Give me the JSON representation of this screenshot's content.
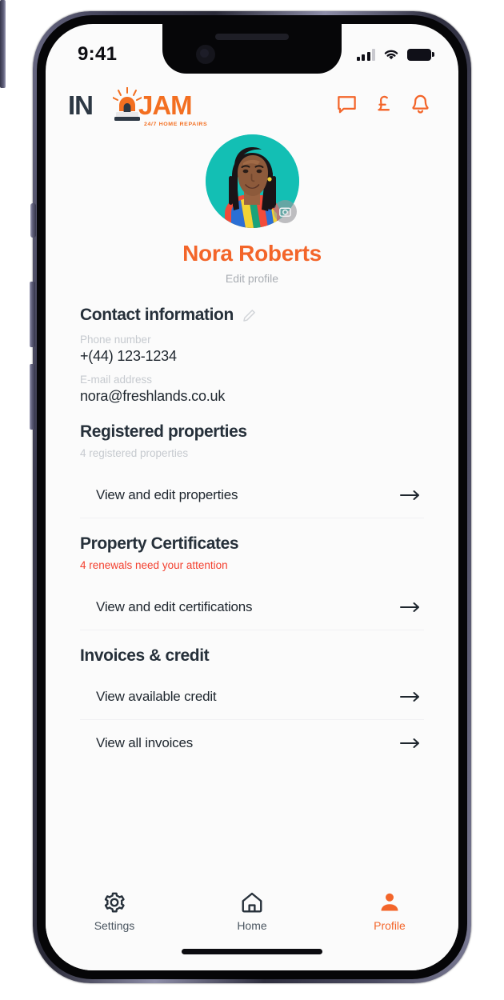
{
  "status_bar": {
    "time": "9:41",
    "signal_icon": "signal-bars-icon",
    "wifi_icon": "wifi-icon",
    "battery_icon": "battery-icon"
  },
  "header": {
    "logo": {
      "part1": "IN",
      "part2": "A",
      "part3": "JAM",
      "tagline": "24/7 HOME REPAIRS"
    },
    "icons": [
      {
        "name": "chat-icon",
        "label": "Messages"
      },
      {
        "name": "pound-icon",
        "label": "Payments"
      },
      {
        "name": "bell-icon",
        "label": "Notifications"
      }
    ]
  },
  "profile": {
    "name": "Nora Roberts",
    "edit_label": "Edit profile",
    "avatar_bg": "#13bfb4",
    "camera_badge": "camera-icon"
  },
  "sections": [
    {
      "id": "contact-information",
      "title": "Contact information",
      "edit_icon": "pencil-icon",
      "fields": [
        {
          "label": "Phone number",
          "value": "+(44) 123-1234"
        },
        {
          "label": "E-mail address",
          "value": "nora@freshlands.co.uk"
        }
      ]
    },
    {
      "id": "registered-properties",
      "title": "Registered properties",
      "subtitle": "4 registered properties",
      "subtitle_alert": false,
      "rows": [
        {
          "label": "View and edit properties"
        }
      ]
    },
    {
      "id": "property-certificates",
      "title": "Property Certificates",
      "subtitle": "4 renewals need your attention",
      "subtitle_alert": true,
      "rows": [
        {
          "label": "View and edit certifications"
        }
      ]
    },
    {
      "id": "invoices-credit",
      "title": "Invoices & credit",
      "rows": [
        {
          "label": "View available credit"
        },
        {
          "label": "View all invoices"
        }
      ]
    }
  ],
  "tabbar": [
    {
      "id": "settings",
      "label": "Settings",
      "icon": "gear-icon",
      "active": false
    },
    {
      "id": "home",
      "label": "Home",
      "icon": "house-icon",
      "active": false
    },
    {
      "id": "profile",
      "label": "Profile",
      "icon": "person-icon",
      "active": true
    }
  ],
  "colors": {
    "accent": "#f3652a",
    "alert": "#f3402f",
    "text": "#1e262e",
    "muted": "#c6cacf"
  }
}
